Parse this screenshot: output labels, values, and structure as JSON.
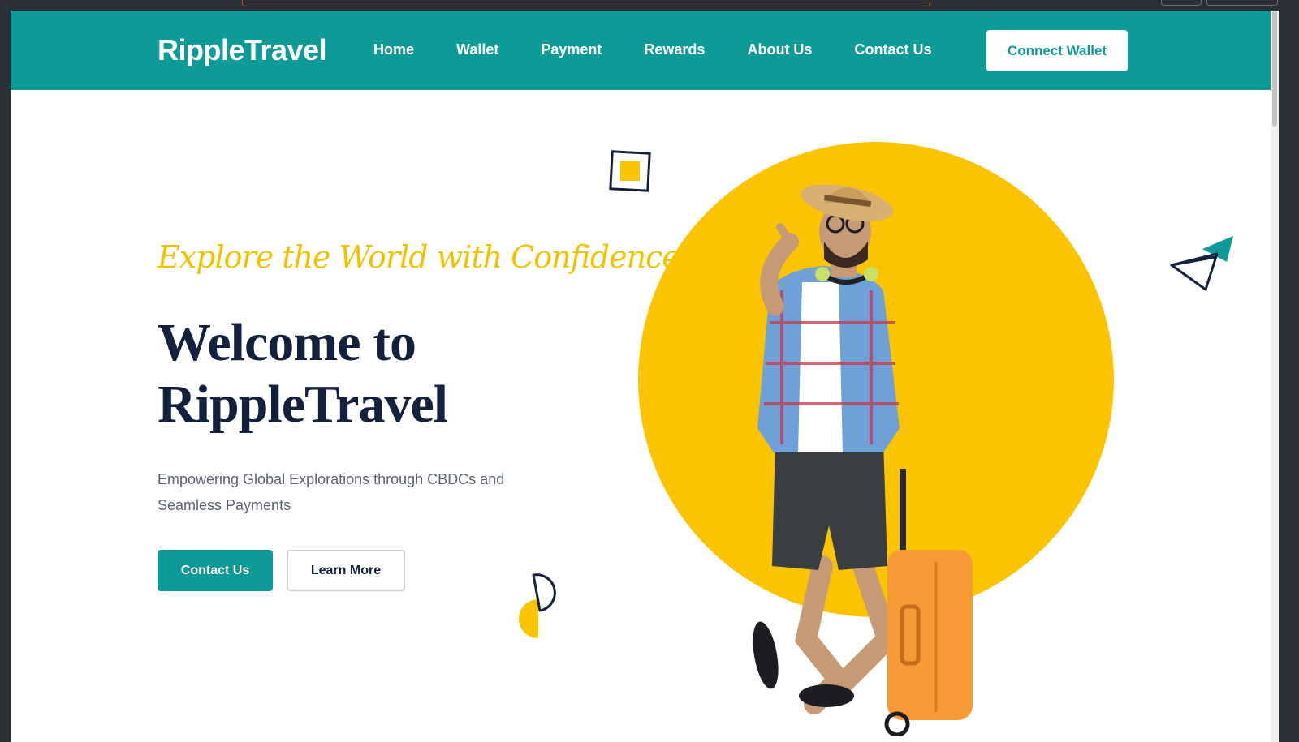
{
  "header": {
    "logo": "RippleTravel",
    "nav": [
      "Home",
      "Wallet",
      "Payment",
      "Rewards",
      "About Us",
      "Contact Us"
    ],
    "connect_label": "Connect Wallet"
  },
  "hero": {
    "tagline": "Explore the World with Confidence",
    "title_line1": "Welcome to",
    "title_line2": "RippleTravel",
    "subtitle": "Empowering Global Explorations through CBDCs and Seamless Payments",
    "contact_label": "Contact Us",
    "learn_label": "Learn More"
  },
  "colors": {
    "brand": "#0e9b98",
    "accent": "#fac400",
    "heading": "#14213d"
  },
  "icons": [
    "paper-plane-icon",
    "square-frame-icon",
    "half-circle-icon"
  ]
}
